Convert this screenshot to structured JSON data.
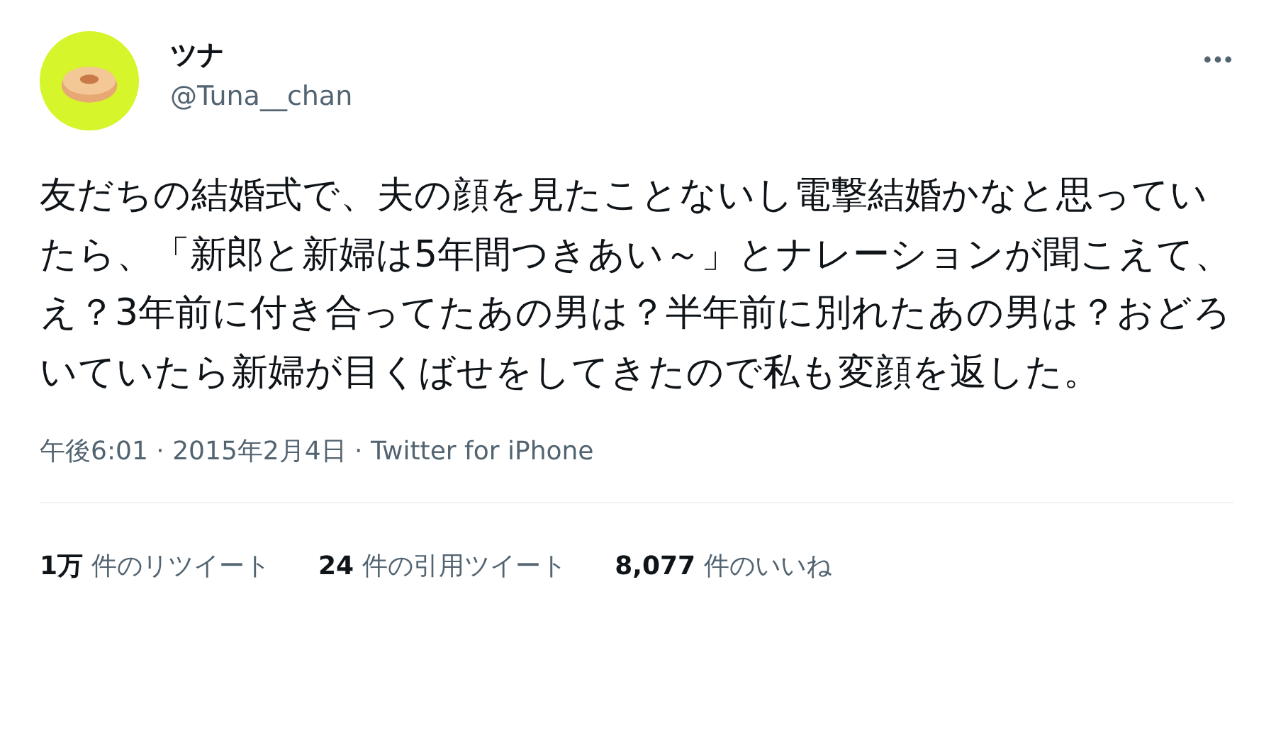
{
  "author": {
    "name": "ツナ",
    "handle": "@Tuna__chan"
  },
  "text": "友だちの結婚式で、夫の顔を見たことないし電撃結婚かなと思っていたら、「新郎と新婦は5年間つきあい～」とナレーションが聞こえて、え？3年前に付き合ってたあの男は？半年前に別れたあの男は？おどろいていたら新婦が目くばせをしてきたので私も変顔を返した。",
  "meta": "午後6:01 · 2015年2月4日 · Twitter for iPhone",
  "stats": [
    {
      "count": "1万",
      "label": "件のリツイート"
    },
    {
      "count": "24",
      "label": "件の引用ツイート"
    },
    {
      "count": "8,077",
      "label": "件のいいね"
    }
  ]
}
